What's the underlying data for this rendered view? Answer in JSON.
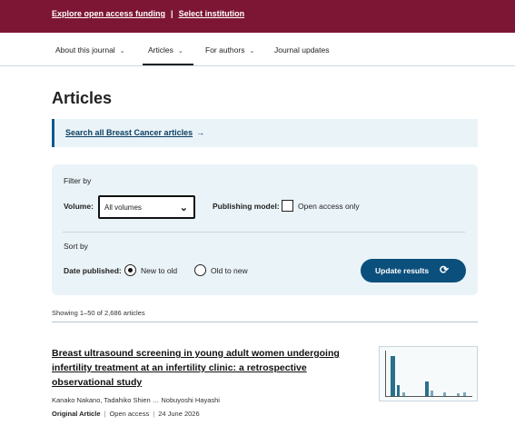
{
  "topbar": {
    "funding_link": "Explore open access funding",
    "separator": "|",
    "institution_link": "Select institution"
  },
  "nav": {
    "tabs": [
      {
        "label": "About this journal",
        "dropdown": true
      },
      {
        "label": "Articles",
        "dropdown": true,
        "active": true
      },
      {
        "label": "For authors",
        "dropdown": true
      },
      {
        "label": "Journal updates",
        "dropdown": false
      }
    ]
  },
  "page": {
    "title": "Articles"
  },
  "search": {
    "link": "Search all Breast Cancer articles",
    "icon": "arrow-right-icon"
  },
  "filters": {
    "filter_by": "Filter by",
    "volume_label": "Volume:",
    "volume_value": "All volumes",
    "publishing_model_label": "Publishing model:",
    "open_access_label": "Open access only",
    "open_access_checked": false,
    "sort_by": "Sort by",
    "date_published_label": "Date published:",
    "sort_options": [
      {
        "label": "New to old",
        "selected": true
      },
      {
        "label": "Old to new",
        "selected": false
      }
    ],
    "update_button": "Update results",
    "update_icon": "refresh-icon"
  },
  "results": {
    "showing": "Showing 1–50 of 2,686 articles",
    "articles": [
      {
        "title": "Breast ultrasound screening in young adult women undergoing infertility treatment at an infertility clinic: a retrospective observational study",
        "authors": "Kanako Nakano, Tadahiko Shien … Nobuyoshi Hayashi",
        "type": "Original Article",
        "access": "Open access",
        "date": "24 June 2026"
      }
    ]
  },
  "colors": {
    "topbar": "#7d1534",
    "accent": "#0b4f7c",
    "panel": "#eaf3f8"
  }
}
